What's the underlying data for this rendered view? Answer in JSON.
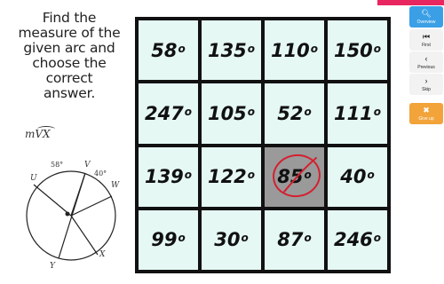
{
  "instructions": {
    "lines": [
      "Find the",
      "measure of the",
      "given arc and",
      "choose the",
      "correct",
      "answer."
    ],
    "arc_label": "mVX"
  },
  "figure": {
    "labels": {
      "u": "U",
      "v": "V",
      "w": "W",
      "x": "X",
      "y": "Y"
    },
    "angle_labels": [
      "58°",
      "40°"
    ]
  },
  "grid": {
    "cells": [
      {
        "value": "58",
        "deg": "o"
      },
      {
        "value": "135",
        "deg": "o"
      },
      {
        "value": "110",
        "deg": "o"
      },
      {
        "value": "150",
        "deg": "o"
      },
      {
        "value": "247",
        "deg": "o"
      },
      {
        "value": "105",
        "deg": "o"
      },
      {
        "value": "52",
        "deg": "o"
      },
      {
        "value": "111",
        "deg": "o"
      },
      {
        "value": "139",
        "deg": "o"
      },
      {
        "value": "122",
        "deg": "o"
      },
      {
        "value": "85",
        "deg": "o"
      },
      {
        "value": "40",
        "deg": "o"
      },
      {
        "value": "99",
        "deg": "o"
      },
      {
        "value": "30",
        "deg": "o"
      },
      {
        "value": "87",
        "deg": "o"
      },
      {
        "value": "246",
        "deg": "o"
      }
    ],
    "selected_index": 10
  },
  "toolbar": {
    "overview": {
      "label": "Overview",
      "icon": "search-icon"
    },
    "first": {
      "label": "First",
      "icon": "skip-first-icon"
    },
    "previous": {
      "label": "Previous",
      "icon": "chevron-left-icon"
    },
    "skip": {
      "label": "Skip",
      "icon": "chevron-right-icon"
    },
    "give_up": {
      "label": "Give up",
      "icon": "close-icon"
    }
  },
  "colors": {
    "cell_bg": "#e5f8f4",
    "selected_bg": "#9a9a9a",
    "mark_red": "#d42030",
    "overview_blue": "#3b9fe6",
    "giveup_orange": "#f2a33a"
  }
}
